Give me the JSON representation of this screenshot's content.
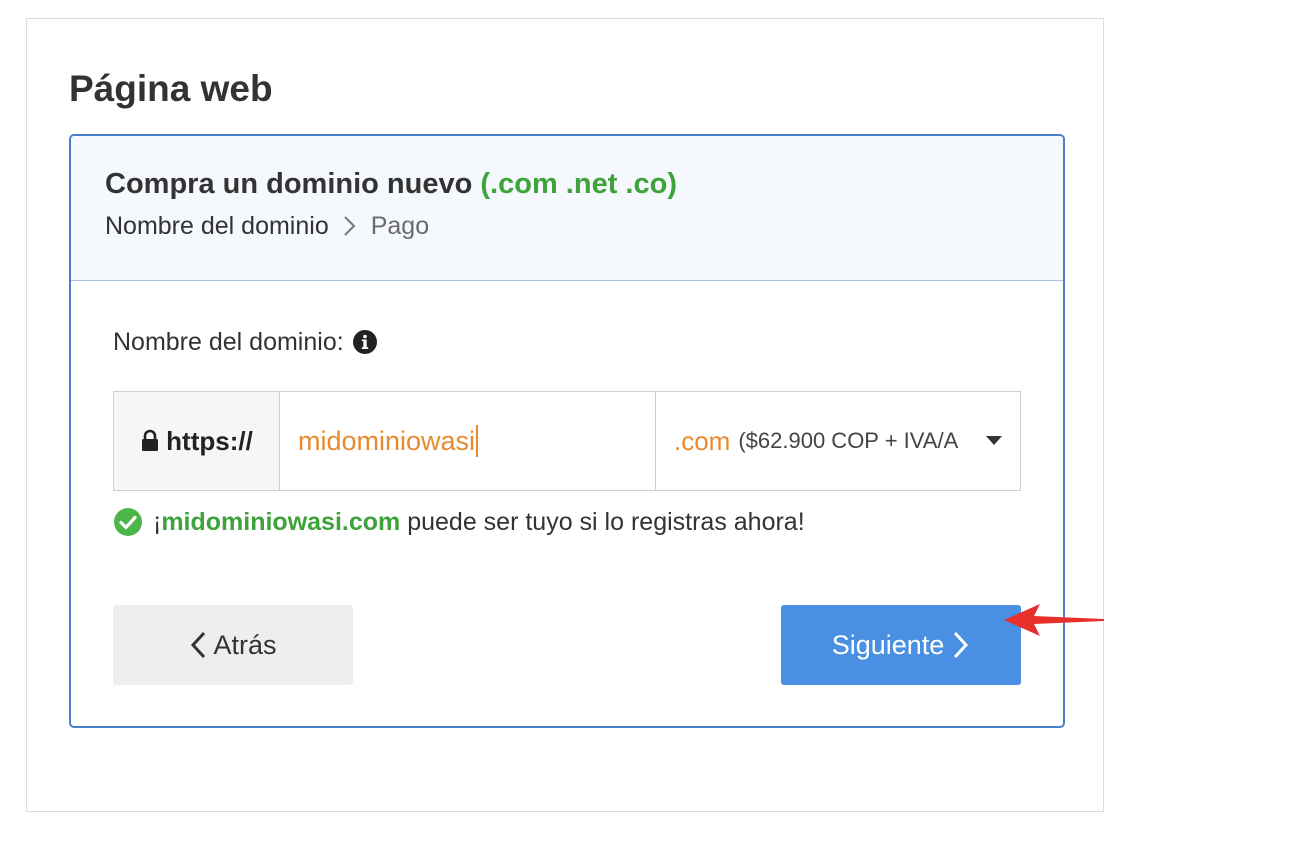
{
  "page": {
    "title": "Página web"
  },
  "card": {
    "title_main": "Compra un dominio nuevo",
    "title_tlds": "(.com .net .co)",
    "steps": {
      "active": "Nombre del dominio",
      "next": "Pago",
      "separator_icon": "chevron-right-icon"
    }
  },
  "form": {
    "label": "Nombre del dominio:",
    "info_icon": "info-circle-icon",
    "prefix_icon": "lock-icon",
    "prefix": "https://",
    "domain_value": "midominiowasi",
    "tld_ext": ".com",
    "tld_price": "($62.900 COP + IVA/A",
    "dropdown_icon": "caret-down-icon"
  },
  "availability": {
    "icon": "check-circle-icon",
    "open_mark": "¡",
    "domain": "midominiowasi.com",
    "message": "puede ser tuyo si lo registras ahora!"
  },
  "buttons": {
    "back_label": "Atrás",
    "next_label": "Siguiente"
  },
  "colors": {
    "accent_blue": "#4a90e2",
    "card_border": "#4a7fcc",
    "success_green": "#3da33a",
    "input_orange": "#e8892c",
    "annotation_red": "#e8302a"
  }
}
